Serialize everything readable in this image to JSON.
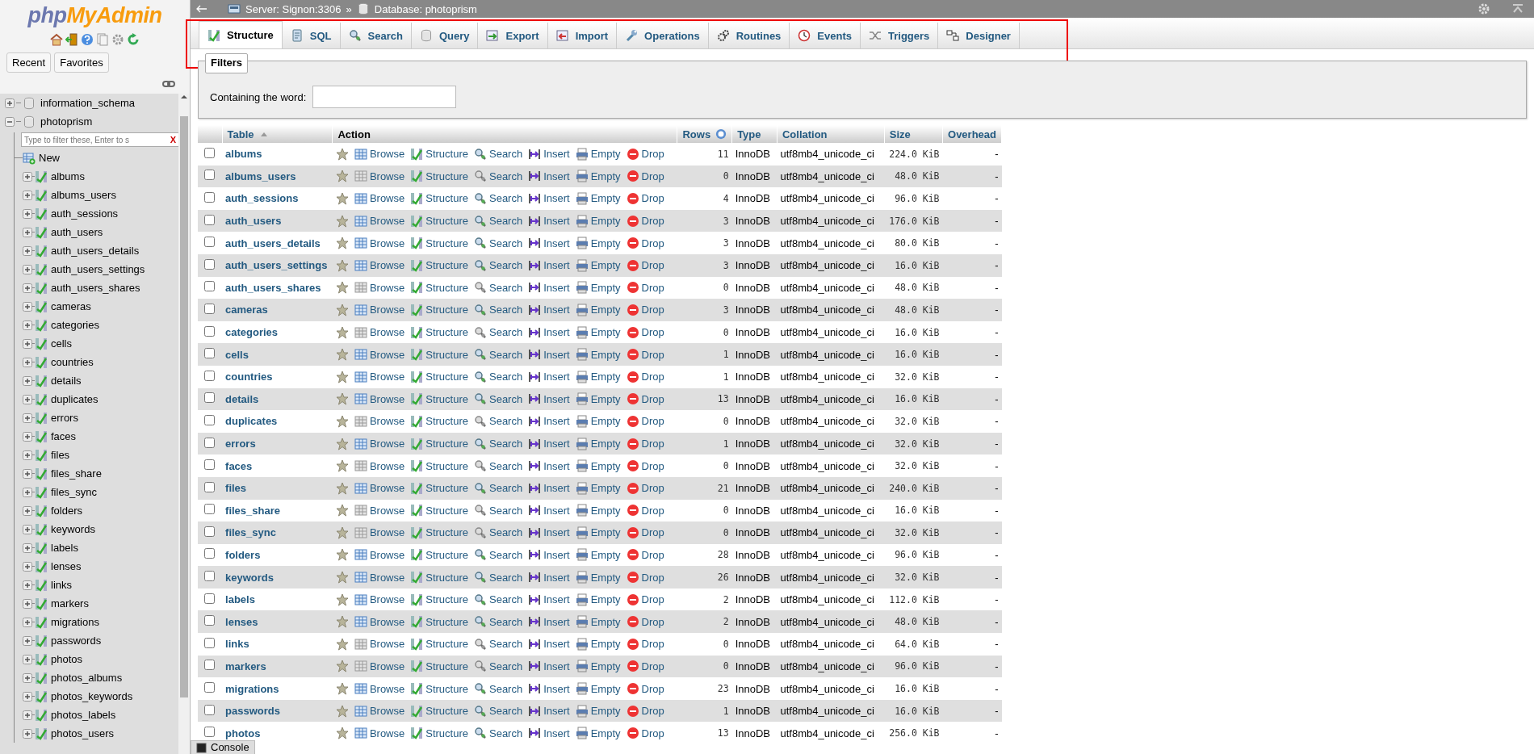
{
  "sidebar": {
    "logo": {
      "part_1": "php",
      "part_2": "MyAdmin"
    },
    "buttons": [
      "Recent",
      "Favorites"
    ],
    "tree": [
      {
        "name": "information_schema",
        "expanded": false
      },
      {
        "name": "photoprism",
        "expanded": true,
        "filter": {
          "placeholder": "Type to filter these, Enter to s",
          "clear": "X"
        },
        "children": [
          {
            "name": "New",
            "kind": "new"
          },
          {
            "name": "albums",
            "kind": "table"
          },
          {
            "name": "albums_users",
            "kind": "table"
          },
          {
            "name": "auth_sessions",
            "kind": "table"
          },
          {
            "name": "auth_users",
            "kind": "table"
          },
          {
            "name": "auth_users_details",
            "kind": "table"
          },
          {
            "name": "auth_users_settings",
            "kind": "table"
          },
          {
            "name": "auth_users_shares",
            "kind": "table"
          },
          {
            "name": "cameras",
            "kind": "table"
          },
          {
            "name": "categories",
            "kind": "table"
          },
          {
            "name": "cells",
            "kind": "table"
          },
          {
            "name": "countries",
            "kind": "table"
          },
          {
            "name": "details",
            "kind": "table"
          },
          {
            "name": "duplicates",
            "kind": "table"
          },
          {
            "name": "errors",
            "kind": "table"
          },
          {
            "name": "faces",
            "kind": "table"
          },
          {
            "name": "files",
            "kind": "table"
          },
          {
            "name": "files_share",
            "kind": "table"
          },
          {
            "name": "files_sync",
            "kind": "table"
          },
          {
            "name": "folders",
            "kind": "table"
          },
          {
            "name": "keywords",
            "kind": "table"
          },
          {
            "name": "labels",
            "kind": "table"
          },
          {
            "name": "lenses",
            "kind": "table"
          },
          {
            "name": "links",
            "kind": "table"
          },
          {
            "name": "markers",
            "kind": "table"
          },
          {
            "name": "migrations",
            "kind": "table"
          },
          {
            "name": "passwords",
            "kind": "table"
          },
          {
            "name": "photos",
            "kind": "table"
          },
          {
            "name": "photos_albums",
            "kind": "table"
          },
          {
            "name": "photos_keywords",
            "kind": "table"
          },
          {
            "name": "photos_labels",
            "kind": "table"
          },
          {
            "name": "photos_users",
            "kind": "table"
          }
        ]
      }
    ]
  },
  "breadcrumb": {
    "items": [
      "Server: Signon:3306",
      "Database: photoprism"
    ],
    "separator": "»"
  },
  "tabs": [
    {
      "label": "Structure",
      "kind": "structure",
      "selected": true
    },
    {
      "label": "SQL",
      "kind": "sql",
      "selected": false
    },
    {
      "label": "Search",
      "kind": "search",
      "selected": false
    },
    {
      "label": "Query",
      "kind": "query",
      "selected": false
    },
    {
      "label": "Export",
      "kind": "export",
      "selected": false
    },
    {
      "label": "Import",
      "kind": "import",
      "selected": false
    },
    {
      "label": "Operations",
      "kind": "operations",
      "selected": false
    },
    {
      "label": "Routines",
      "kind": "routines",
      "selected": false
    },
    {
      "label": "Events",
      "kind": "events",
      "selected": false
    },
    {
      "label": "Triggers",
      "kind": "triggers",
      "selected": false
    },
    {
      "label": "Designer",
      "kind": "designer",
      "selected": false
    }
  ],
  "tabs_highlighted": true,
  "filters": {
    "legend": "Filters",
    "label": "Containing the word:"
  },
  "table": {
    "columns": [
      "Table",
      "Action",
      "Rows",
      "Type",
      "Collation",
      "Size",
      "Overhead"
    ],
    "rows": [
      {
        "name": "albums",
        "checked": false,
        "has_data": true,
        "actions": [
          "Browse",
          "Structure",
          "Search",
          "Insert",
          "Empty",
          "Drop"
        ],
        "rows": "11",
        "type": "InnoDB",
        "collation": "utf8mb4_unicode_ci",
        "size": "224.0 KiB",
        "overhead": "-"
      },
      {
        "name": "albums_users",
        "checked": false,
        "has_data": false,
        "actions": [
          "Browse",
          "Structure",
          "Search",
          "Insert",
          "Empty",
          "Drop"
        ],
        "rows": "0",
        "type": "InnoDB",
        "collation": "utf8mb4_unicode_ci",
        "size": "48.0 KiB",
        "overhead": "-"
      },
      {
        "name": "auth_sessions",
        "checked": false,
        "has_data": true,
        "actions": [
          "Browse",
          "Structure",
          "Search",
          "Insert",
          "Empty",
          "Drop"
        ],
        "rows": "4",
        "type": "InnoDB",
        "collation": "utf8mb4_unicode_ci",
        "size": "96.0 KiB",
        "overhead": "-"
      },
      {
        "name": "auth_users",
        "checked": false,
        "has_data": true,
        "actions": [
          "Browse",
          "Structure",
          "Search",
          "Insert",
          "Empty",
          "Drop"
        ],
        "rows": "3",
        "type": "InnoDB",
        "collation": "utf8mb4_unicode_ci",
        "size": "176.0 KiB",
        "overhead": "-"
      },
      {
        "name": "auth_users_details",
        "checked": false,
        "has_data": true,
        "actions": [
          "Browse",
          "Structure",
          "Search",
          "Insert",
          "Empty",
          "Drop"
        ],
        "rows": "3",
        "type": "InnoDB",
        "collation": "utf8mb4_unicode_ci",
        "size": "80.0 KiB",
        "overhead": "-"
      },
      {
        "name": "auth_users_settings",
        "checked": false,
        "has_data": true,
        "actions": [
          "Browse",
          "Structure",
          "Search",
          "Insert",
          "Empty",
          "Drop"
        ],
        "rows": "3",
        "type": "InnoDB",
        "collation": "utf8mb4_unicode_ci",
        "size": "16.0 KiB",
        "overhead": "-"
      },
      {
        "name": "auth_users_shares",
        "checked": false,
        "has_data": false,
        "actions": [
          "Browse",
          "Structure",
          "Search",
          "Insert",
          "Empty",
          "Drop"
        ],
        "rows": "0",
        "type": "InnoDB",
        "collation": "utf8mb4_unicode_ci",
        "size": "48.0 KiB",
        "overhead": "-"
      },
      {
        "name": "cameras",
        "checked": false,
        "has_data": true,
        "actions": [
          "Browse",
          "Structure",
          "Search",
          "Insert",
          "Empty",
          "Drop"
        ],
        "rows": "3",
        "type": "InnoDB",
        "collation": "utf8mb4_unicode_ci",
        "size": "48.0 KiB",
        "overhead": "-"
      },
      {
        "name": "categories",
        "checked": false,
        "has_data": false,
        "actions": [
          "Browse",
          "Structure",
          "Search",
          "Insert",
          "Empty",
          "Drop"
        ],
        "rows": "0",
        "type": "InnoDB",
        "collation": "utf8mb4_unicode_ci",
        "size": "16.0 KiB",
        "overhead": "-"
      },
      {
        "name": "cells",
        "checked": false,
        "has_data": true,
        "actions": [
          "Browse",
          "Structure",
          "Search",
          "Insert",
          "Empty",
          "Drop"
        ],
        "rows": "1",
        "type": "InnoDB",
        "collation": "utf8mb4_unicode_ci",
        "size": "16.0 KiB",
        "overhead": "-"
      },
      {
        "name": "countries",
        "checked": false,
        "has_data": true,
        "actions": [
          "Browse",
          "Structure",
          "Search",
          "Insert",
          "Empty",
          "Drop"
        ],
        "rows": "1",
        "type": "InnoDB",
        "collation": "utf8mb4_unicode_ci",
        "size": "32.0 KiB",
        "overhead": "-"
      },
      {
        "name": "details",
        "checked": false,
        "has_data": true,
        "actions": [
          "Browse",
          "Structure",
          "Search",
          "Insert",
          "Empty",
          "Drop"
        ],
        "rows": "13",
        "type": "InnoDB",
        "collation": "utf8mb4_unicode_ci",
        "size": "16.0 KiB",
        "overhead": "-"
      },
      {
        "name": "duplicates",
        "checked": false,
        "has_data": false,
        "actions": [
          "Browse",
          "Structure",
          "Search",
          "Insert",
          "Empty",
          "Drop"
        ],
        "rows": "0",
        "type": "InnoDB",
        "collation": "utf8mb4_unicode_ci",
        "size": "32.0 KiB",
        "overhead": "-"
      },
      {
        "name": "errors",
        "checked": false,
        "has_data": true,
        "actions": [
          "Browse",
          "Structure",
          "Search",
          "Insert",
          "Empty",
          "Drop"
        ],
        "rows": "1",
        "type": "InnoDB",
        "collation": "utf8mb4_unicode_ci",
        "size": "32.0 KiB",
        "overhead": "-"
      },
      {
        "name": "faces",
        "checked": false,
        "has_data": false,
        "actions": [
          "Browse",
          "Structure",
          "Search",
          "Insert",
          "Empty",
          "Drop"
        ],
        "rows": "0",
        "type": "InnoDB",
        "collation": "utf8mb4_unicode_ci",
        "size": "32.0 KiB",
        "overhead": "-"
      },
      {
        "name": "files",
        "checked": false,
        "has_data": true,
        "actions": [
          "Browse",
          "Structure",
          "Search",
          "Insert",
          "Empty",
          "Drop"
        ],
        "rows": "21",
        "type": "InnoDB",
        "collation": "utf8mb4_unicode_ci",
        "size": "240.0 KiB",
        "overhead": "-"
      },
      {
        "name": "files_share",
        "checked": false,
        "has_data": false,
        "actions": [
          "Browse",
          "Structure",
          "Search",
          "Insert",
          "Empty",
          "Drop"
        ],
        "rows": "0",
        "type": "InnoDB",
        "collation": "utf8mb4_unicode_ci",
        "size": "16.0 KiB",
        "overhead": "-"
      },
      {
        "name": "files_sync",
        "checked": false,
        "has_data": false,
        "actions": [
          "Browse",
          "Structure",
          "Search",
          "Insert",
          "Empty",
          "Drop"
        ],
        "rows": "0",
        "type": "InnoDB",
        "collation": "utf8mb4_unicode_ci",
        "size": "32.0 KiB",
        "overhead": "-"
      },
      {
        "name": "folders",
        "checked": false,
        "has_data": true,
        "actions": [
          "Browse",
          "Structure",
          "Search",
          "Insert",
          "Empty",
          "Drop"
        ],
        "rows": "28",
        "type": "InnoDB",
        "collation": "utf8mb4_unicode_ci",
        "size": "96.0 KiB",
        "overhead": "-"
      },
      {
        "name": "keywords",
        "checked": false,
        "has_data": true,
        "actions": [
          "Browse",
          "Structure",
          "Search",
          "Insert",
          "Empty",
          "Drop"
        ],
        "rows": "26",
        "type": "InnoDB",
        "collation": "utf8mb4_unicode_ci",
        "size": "32.0 KiB",
        "overhead": "-"
      },
      {
        "name": "labels",
        "checked": false,
        "has_data": true,
        "actions": [
          "Browse",
          "Structure",
          "Search",
          "Insert",
          "Empty",
          "Drop"
        ],
        "rows": "2",
        "type": "InnoDB",
        "collation": "utf8mb4_unicode_ci",
        "size": "112.0 KiB",
        "overhead": "-"
      },
      {
        "name": "lenses",
        "checked": false,
        "has_data": true,
        "actions": [
          "Browse",
          "Structure",
          "Search",
          "Insert",
          "Empty",
          "Drop"
        ],
        "rows": "2",
        "type": "InnoDB",
        "collation": "utf8mb4_unicode_ci",
        "size": "48.0 KiB",
        "overhead": "-"
      },
      {
        "name": "links",
        "checked": false,
        "has_data": false,
        "actions": [
          "Browse",
          "Structure",
          "Search",
          "Insert",
          "Empty",
          "Drop"
        ],
        "rows": "0",
        "type": "InnoDB",
        "collation": "utf8mb4_unicode_ci",
        "size": "64.0 KiB",
        "overhead": "-"
      },
      {
        "name": "markers",
        "checked": false,
        "has_data": false,
        "actions": [
          "Browse",
          "Structure",
          "Search",
          "Insert",
          "Empty",
          "Drop"
        ],
        "rows": "0",
        "type": "InnoDB",
        "collation": "utf8mb4_unicode_ci",
        "size": "96.0 KiB",
        "overhead": "-"
      },
      {
        "name": "migrations",
        "checked": false,
        "has_data": true,
        "actions": [
          "Browse",
          "Structure",
          "Search",
          "Insert",
          "Empty",
          "Drop"
        ],
        "rows": "23",
        "type": "InnoDB",
        "collation": "utf8mb4_unicode_ci",
        "size": "16.0 KiB",
        "overhead": "-"
      },
      {
        "name": "passwords",
        "checked": false,
        "has_data": true,
        "actions": [
          "Browse",
          "Structure",
          "Search",
          "Insert",
          "Empty",
          "Drop"
        ],
        "rows": "1",
        "type": "InnoDB",
        "collation": "utf8mb4_unicode_ci",
        "size": "16.0 KiB",
        "overhead": "-"
      },
      {
        "name": "photos",
        "checked": false,
        "has_data": true,
        "actions": [
          "Browse",
          "Structure",
          "Search",
          "Insert",
          "Empty",
          "Drop"
        ],
        "rows": "13",
        "type": "InnoDB",
        "collation": "utf8mb4_unicode_ci",
        "size": "256.0 KiB",
        "overhead": "-"
      }
    ]
  },
  "console": {
    "label": "Console"
  }
}
